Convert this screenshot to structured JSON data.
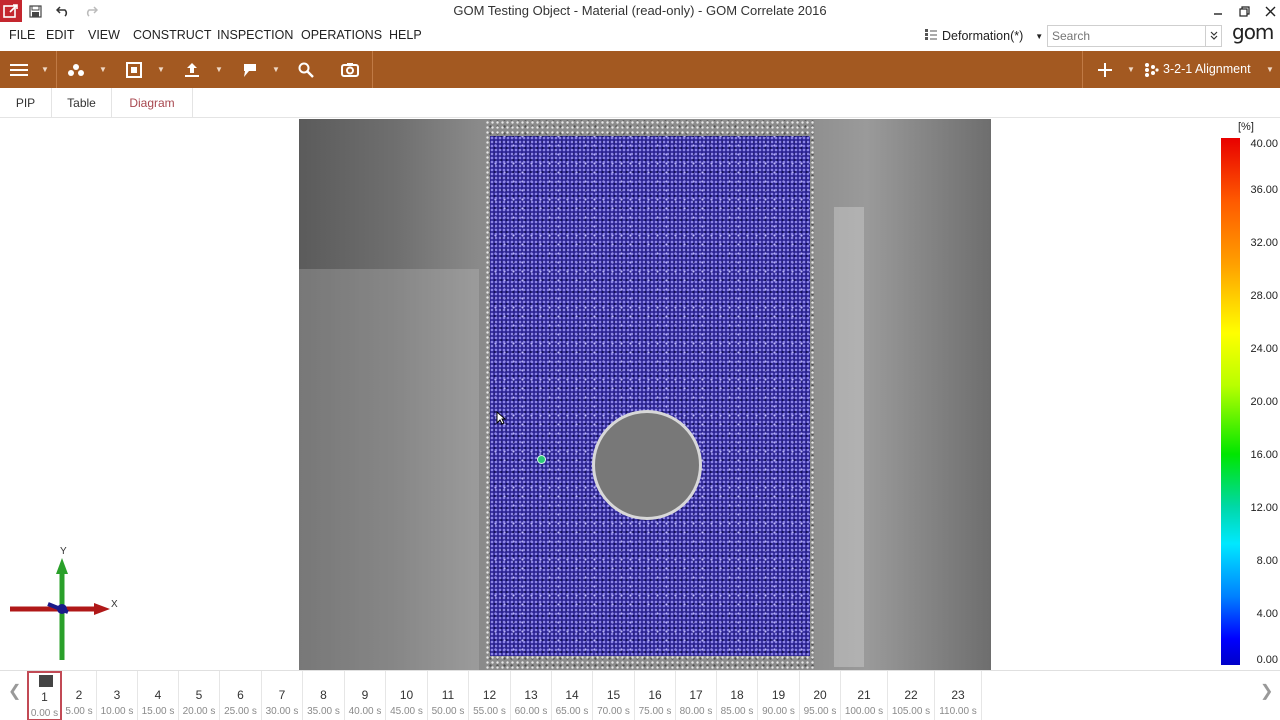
{
  "window": {
    "title": "GOM Testing Object - Material (read-only) - GOM Correlate 2016",
    "app_icon": "gom-app-icon",
    "quick_access": [
      "save-icon",
      "undo-icon",
      "redo-icon"
    ],
    "controls": [
      "minimize-icon",
      "restore-icon",
      "close-icon"
    ]
  },
  "menu": {
    "items": [
      "FILE",
      "EDIT",
      "VIEW",
      "CONSTRUCT",
      "INSPECTION",
      "OPERATIONS",
      "HELP"
    ],
    "mode": "Deformation(*)",
    "search_placeholder": "Search",
    "logo": "gom"
  },
  "toolbar": {
    "background": "#a35921",
    "tools": [
      "hamburger-menu-icon",
      "molecule-icon",
      "frame-icon",
      "upload-icon",
      "label-icon",
      "search-icon",
      "camera-icon"
    ],
    "alignment": "3-2-1 Alignment"
  },
  "tabs": {
    "items": [
      "PIP",
      "Table",
      "Diagram"
    ],
    "active": "Diagram",
    "active_color": "#a8474f"
  },
  "view": {
    "axis_x": "X",
    "axis_y": "Y"
  },
  "legend": {
    "unit": "[%]",
    "labels": [
      "40.00",
      "36.00",
      "32.00",
      "28.00",
      "24.00",
      "20.00",
      "16.00",
      "12.00",
      "8.00",
      "4.00",
      "0.00"
    ],
    "max": 40,
    "min": 0
  },
  "timeline": {
    "current_stage": 1,
    "stages": [
      {
        "num": "1",
        "time": "0.00 s"
      },
      {
        "num": "2",
        "time": "5.00 s"
      },
      {
        "num": "3",
        "time": "10.00 s"
      },
      {
        "num": "4",
        "time": "15.00 s"
      },
      {
        "num": "5",
        "time": "20.00 s"
      },
      {
        "num": "6",
        "time": "25.00 s"
      },
      {
        "num": "7",
        "time": "30.00 s"
      },
      {
        "num": "8",
        "time": "35.00 s"
      },
      {
        "num": "9",
        "time": "40.00 s"
      },
      {
        "num": "10",
        "time": "45.00 s"
      },
      {
        "num": "11",
        "time": "50.00 s"
      },
      {
        "num": "12",
        "time": "55.00 s"
      },
      {
        "num": "13",
        "time": "60.00 s"
      },
      {
        "num": "14",
        "time": "65.00 s"
      },
      {
        "num": "15",
        "time": "70.00 s"
      },
      {
        "num": "16",
        "time": "75.00 s"
      },
      {
        "num": "17",
        "time": "80.00 s"
      },
      {
        "num": "18",
        "time": "85.00 s"
      },
      {
        "num": "19",
        "time": "90.00 s"
      },
      {
        "num": "20",
        "time": "95.00 s"
      },
      {
        "num": "21",
        "time": "100.00 s"
      },
      {
        "num": "22",
        "time": "105.00 s"
      },
      {
        "num": "23",
        "time": "110.00 s"
      }
    ]
  }
}
